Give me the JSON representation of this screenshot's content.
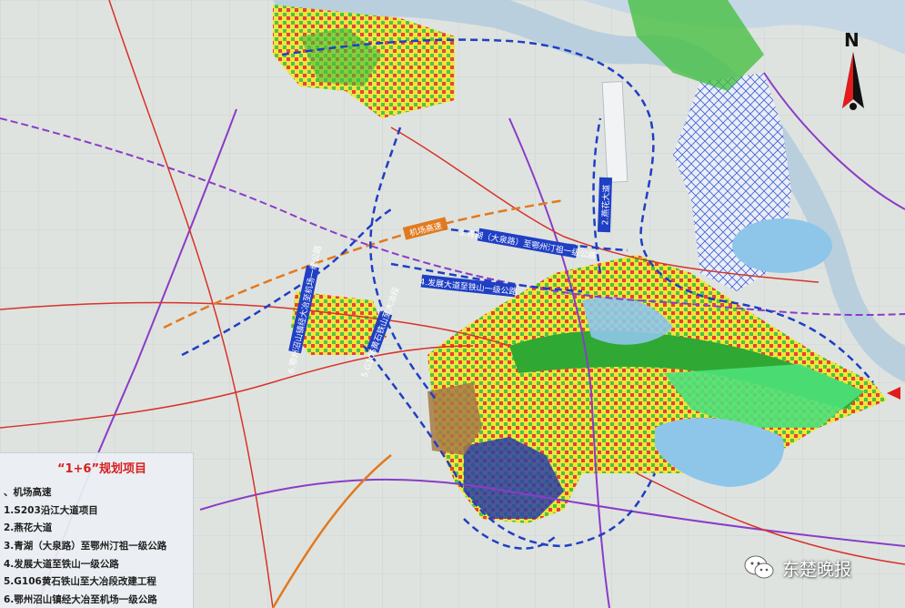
{
  "map": {
    "legend": {
      "title": "“1+6”规划项目",
      "items": [
        "、机场高速",
        "1.S203沿江大道项目",
        "2.燕花大道",
        "3.青湖（大泉路）至鄂州汀祖一级公路",
        "4.发展大道至铁山一级公路",
        "5.G106黄石铁山至大冶段改建工程",
        "6.鄂州沼山镇经大冶至机场一级公路"
      ]
    },
    "road_labels": {
      "yanhua": "2.燕花大道",
      "qinghu": "3.青湖（大泉路）至鄂州汀祖一级公路",
      "fazhan": "4.发展大道至铁山一级公路",
      "zhaoshan": "6.鄂州沼山镇经大冶至机场一级公路",
      "g106": "5.G106黄石铁山至大冶段",
      "airport": "机场高速"
    },
    "compass_label": "N",
    "watermark": "东楚晚报",
    "colors": {
      "river": "#b9cfde",
      "planned_road": "#1f3fc4",
      "expressway": "#e07a20",
      "railway": "#8a3cc8",
      "urban_yellow": "#f2e62a",
      "urban_green": "#3fbf3a",
      "lake": "#8ec6ea"
    }
  }
}
